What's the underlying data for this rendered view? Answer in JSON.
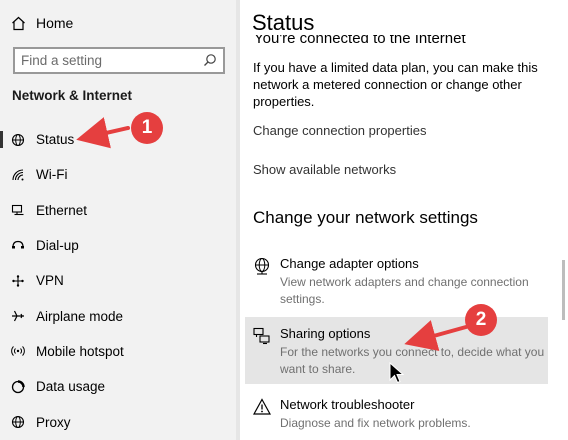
{
  "sidebar": {
    "home_label": "Home",
    "search_placeholder": "Find a setting",
    "section_title": "Network & Internet",
    "items": [
      {
        "label": "Status",
        "icon": "globe-icon"
      },
      {
        "label": "Wi-Fi",
        "icon": "wifi-icon"
      },
      {
        "label": "Ethernet",
        "icon": "ethernet-icon"
      },
      {
        "label": "Dial-up",
        "icon": "dialup-icon"
      },
      {
        "label": "VPN",
        "icon": "vpn-icon"
      },
      {
        "label": "Airplane mode",
        "icon": "airplane-icon"
      },
      {
        "label": "Mobile hotspot",
        "icon": "hotspot-icon"
      },
      {
        "label": "Data usage",
        "icon": "data-usage-icon"
      },
      {
        "label": "Proxy",
        "icon": "globe-icon"
      }
    ]
  },
  "main": {
    "title": "Status",
    "cut_heading": "You're connected to the Internet",
    "paragraph": "If you have a limited data plan, you can make this network a metered connection or change other properties.",
    "links": {
      "change_connection": "Change connection properties",
      "show_networks": "Show available networks"
    },
    "section_heading": "Change your network settings",
    "options": [
      {
        "title": "Change adapter options",
        "desc": "View network adapters and change connection settings.",
        "icon": "adapter-icon"
      },
      {
        "title": "Sharing options",
        "desc": "For the networks you connect to, decide what you want to share.",
        "icon": "sharing-icon"
      },
      {
        "title": "Network troubleshooter",
        "desc": "Diagnose and fix network problems.",
        "icon": "warning-icon"
      }
    ]
  },
  "annotations": {
    "badge1": "1",
    "badge2": "2",
    "color": "#e53f3f"
  }
}
